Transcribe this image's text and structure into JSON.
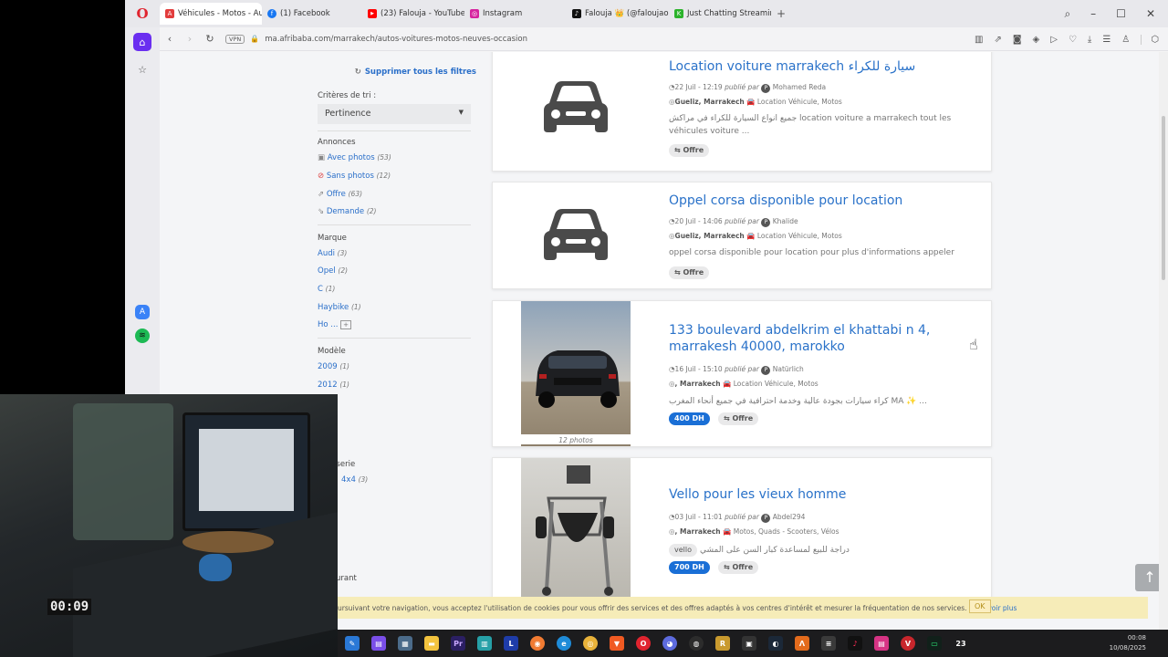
{
  "browser": {
    "tabs": [
      {
        "label": "Véhicules - Motos - Auto",
        "color": "#e23c3c",
        "glyph": "A",
        "active": true
      },
      {
        "label": "(1) Facebook",
        "color": "#1877f2",
        "glyph": "f"
      },
      {
        "label": "(23) Falouja - YouTube",
        "color": "#ff0000",
        "glyph": "▶"
      },
      {
        "label": "Instagram",
        "color": "#d6249f",
        "glyph": "◎"
      },
      {
        "label": "Falouja 👑 (@faloujao",
        "color": "#111111",
        "glyph": "♪"
      },
      {
        "label": "Just Chatting Streaming",
        "color": "#2bb32b",
        "glyph": "K"
      }
    ],
    "new_tab_label": "+",
    "url": "ma.afribaba.com/marrakech/autos-voitures-motos-neuves-occasion",
    "vpn_label": "VPN"
  },
  "filters": {
    "clear_all": "Supprimer tous les filtres",
    "sort_label": "Critères de tri :",
    "sort_value": "Pertinence",
    "annonces": {
      "title": "Annonces",
      "items": [
        {
          "label": "Avec photos",
          "count": "(53)"
        },
        {
          "label": "Sans photos",
          "count": "(12)"
        },
        {
          "label": "Offre",
          "count": "(63)"
        },
        {
          "label": "Demande",
          "count": "(2)"
        }
      ]
    },
    "marque": {
      "title": "Marque",
      "items": [
        {
          "label": "Audi",
          "count": "(3)"
        },
        {
          "label": "Opel",
          "count": "(2)"
        },
        {
          "label": "C",
          "count": "(1)"
        },
        {
          "label": "Haybike",
          "count": "(1)"
        },
        {
          "label": "Ho ...",
          "count": ""
        }
      ]
    },
    "modele": {
      "title": "Modèle",
      "items": [
        {
          "label": "2009",
          "count": "(1)"
        },
        {
          "label": "2012",
          "count": "(1)"
        }
      ]
    },
    "carrosserie_title": "sserie",
    "carrosserie_first": "4x4",
    "carrosserie_first_count": "(3)",
    "carburant_title": "urant"
  },
  "listings": [
    {
      "title": "Location voiture marrakech سيارة للكراء",
      "date": "22 Juil - 12:19",
      "published_by": "publié par",
      "author": "Mohamed Reda",
      "location": "Gueliz, Marrakech",
      "category": "Location Véhicule, Motos",
      "description": "جميع انواع السيارة للكراء في مراكش location voiture a marrakech tout les véhicules voiture ...",
      "tag": "Offre",
      "price": ""
    },
    {
      "title": "Oppel corsa disponible pour location",
      "date": "20 Juil - 14:06",
      "published_by": "publié par",
      "author": "Khalide",
      "location": "Gueliz, Marrakech",
      "category": "Location Véhicule, Motos",
      "description": "oppel corsa disponible pour location pour plus d'informations appeler",
      "tag": "Offre",
      "price": ""
    },
    {
      "title": "133 boulevard abdelkrim el khattabi n 4, marrakesh 40000, marokko",
      "date": "16 Juil - 15:10",
      "published_by": "publié par",
      "author": "Natürlich",
      "location": ", Marrakech",
      "category": "Location Véhicule, Motos",
      "description": "كراء سيارات بجودة عالية وخدمة احترافية في جميع أنحاء المغرب MA ✨ ...",
      "tag": "Offre",
      "price": "400 DH",
      "photos": "12 photos"
    },
    {
      "title": "Vello pour les vieux homme",
      "date": "03 Juil - 11:01",
      "published_by": "publié par",
      "author": "Abdel294",
      "location": ", Marrakech",
      "category": "Motos, Quads - Scooters, Vélos",
      "description": "دراجة للبيع لمساعدة كبار السن على المشي",
      "category_tag": "vello",
      "tag": "Offre",
      "price": "700 DH"
    }
  ],
  "cookie": {
    "text": "ursuivant votre navigation, vous acceptez l'utilisation de cookies pour vous offrir des services et des offres adaptés à vos centres d'intérêt et mesurer la fréquentation de nos services.",
    "link": "En savoir plus",
    "ok": "OK"
  },
  "taskbar": {
    "time": "00:08",
    "date": "10/08/2025",
    "badge": "23"
  },
  "webcam": {
    "timer": "00:09"
  }
}
